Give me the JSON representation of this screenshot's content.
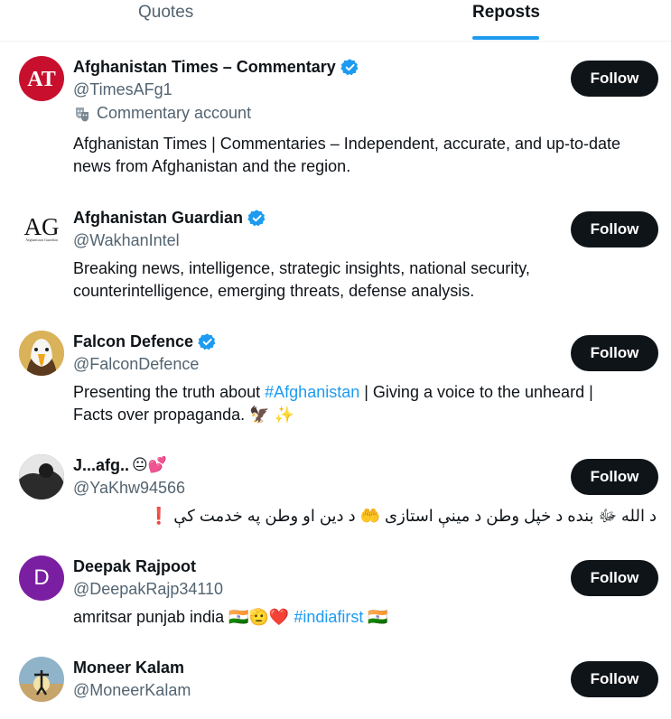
{
  "tabs": {
    "quotes": "Quotes",
    "reposts": "Reposts",
    "active": "Reposts"
  },
  "follow_label": "Follow",
  "colors": {
    "accent": "#1d9bf0",
    "text_primary": "#0f1419",
    "text_secondary": "#536471",
    "follow_bg": "#0f1419"
  },
  "users": [
    {
      "name": "Afghanistan Times – Commentary",
      "handle": "@TimesAFg1",
      "verified": true,
      "avatar_text": "AT",
      "avatar_color": "#c8102e",
      "account_label": "Commentary account",
      "bio": "Afghanistan Times | Commentaries – Independent, accurate, and up-to-date news from Afghanistan and the region."
    },
    {
      "name": "Afghanistan Guardian",
      "handle": "@WakhanIntel",
      "verified": true,
      "avatar_text": "AG",
      "avatar_subtext": "Afghanistan Guardian",
      "bio": "Breaking news, intelligence, strategic insights, national security, counterintelligence, emerging threats, defense analysis."
    },
    {
      "name": "Falcon Defence",
      "handle": "@FalconDefence",
      "verified": true,
      "avatar_icon": "eagle-icon",
      "bio_before": "Presenting the truth about ",
      "bio_link": "#Afghanistan",
      "bio_after": " | Giving a voice to the unheard | Facts over propaganda. 🦅 ✨"
    },
    {
      "name": "J...afg..",
      "name_emoji": "😐💕",
      "handle": "@YaKhw94566",
      "verified": false,
      "bio": "د الله ﷻ بنده د خپل وطن د مینې استازی 🤲 د دین او وطن په خدمت کې ❗"
    },
    {
      "name": "Deepak Rajpoot",
      "handle": "@DeepakRajp34110",
      "verified": false,
      "avatar_text": "D",
      "avatar_color": "#7b1fa2",
      "bio_before": "amritsar punjab india 🇮🇳🫡❤️ ",
      "bio_link": "#indiafirst",
      "bio_after": " 🇮🇳"
    },
    {
      "name": "Moneer Kalam",
      "handle": "@MoneerKalam",
      "verified": false
    }
  ]
}
